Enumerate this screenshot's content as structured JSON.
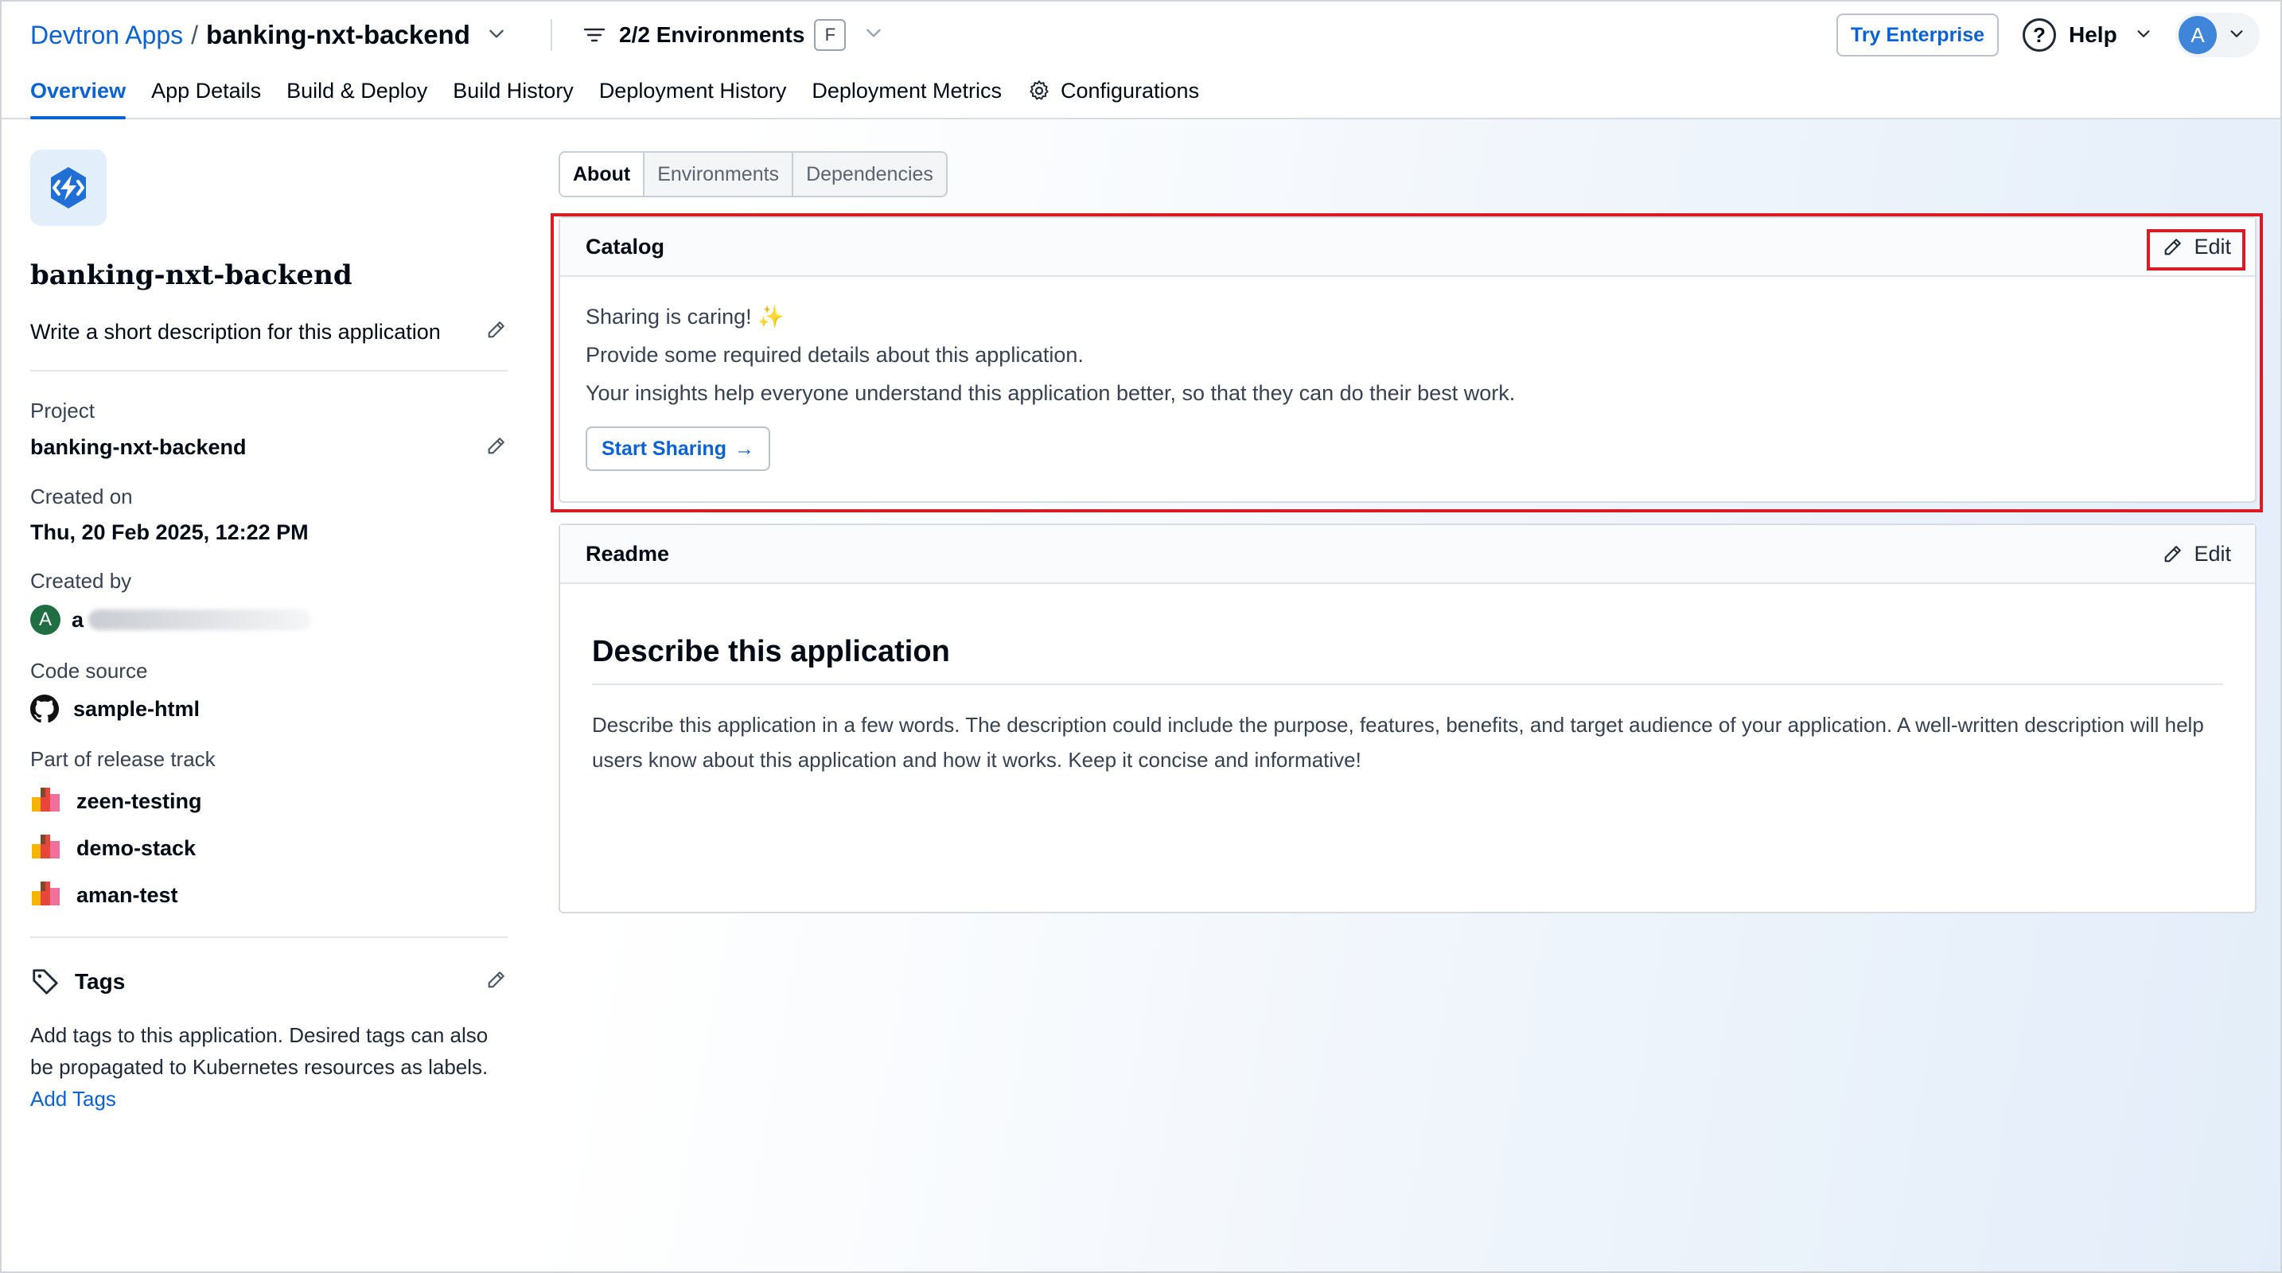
{
  "breadcrumb": {
    "root": "Devtron Apps",
    "separator": "/",
    "app": "banking-nxt-backend"
  },
  "env_filter": {
    "label": "2/2 Environments",
    "badge": "F"
  },
  "header": {
    "try_enterprise": "Try Enterprise",
    "help": "Help",
    "help_icon": "?",
    "avatar_initial": "A"
  },
  "nav_tabs": [
    "Overview",
    "App Details",
    "Build & Deploy",
    "Build History",
    "Deployment History",
    "Deployment Metrics",
    "Configurations"
  ],
  "left": {
    "app_name": "banking-nxt-backend",
    "description_placeholder": "Write a short description for this application",
    "project_label": "Project",
    "project_value": "banking-nxt-backend",
    "created_on_label": "Created on",
    "created_on_value": "Thu, 20 Feb 2025, 12:22 PM",
    "created_by_label": "Created by",
    "created_by_initial": "A",
    "created_by_value": "a",
    "code_source_label": "Code source",
    "code_source_value": "sample-html",
    "release_track_label": "Part of release track",
    "release_tracks": [
      "zeen-testing",
      "demo-stack",
      "aman-test"
    ],
    "tags_label": "Tags",
    "tags_text": "Add tags to this application. Desired tags can also be propagated to Kubernetes resources as labels.",
    "add_tags": "Add Tags"
  },
  "segments": [
    "About",
    "Environments",
    "Dependencies"
  ],
  "catalog": {
    "title": "Catalog",
    "edit": "Edit",
    "line1": "Sharing is caring!",
    "sparkle": "✨",
    "line2": "Provide some required details about this application.",
    "line3": "Your insights help everyone understand this application better, so that they can do their best work.",
    "start_sharing": "Start Sharing",
    "arrow": "→"
  },
  "readme": {
    "title": "Readme",
    "edit": "Edit",
    "heading": "Describe this application",
    "body": "Describe this application in a few words. The description could include the purpose, features, benefits, and target audience of your application. A well-written description will help users know about this application and how it works. Keep it concise and informative!"
  },
  "colors": {
    "accent": "#0b62d4",
    "highlight": "#d81b24"
  }
}
